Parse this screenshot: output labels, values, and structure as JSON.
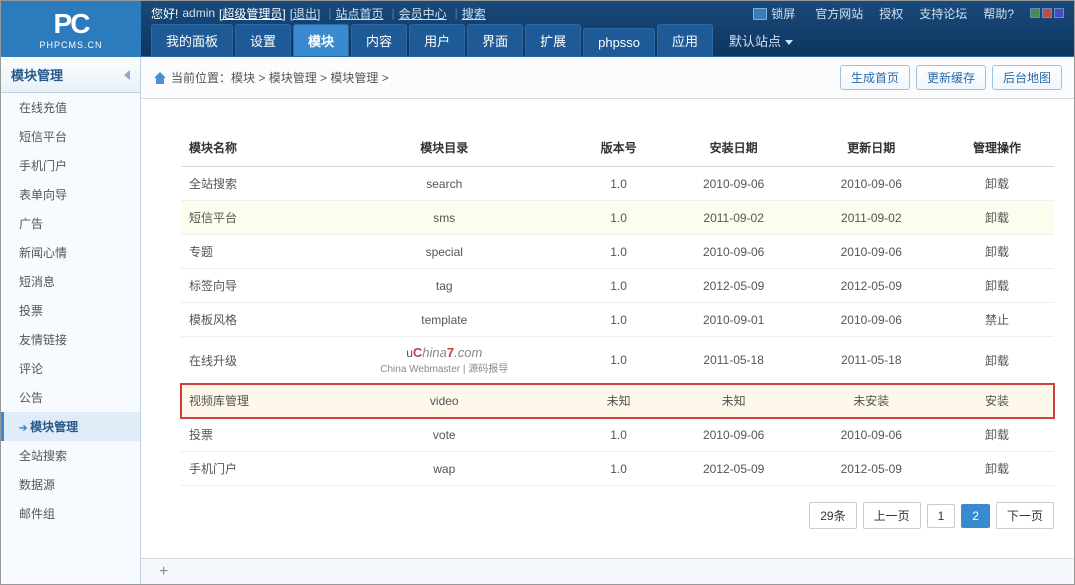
{
  "header": {
    "logo_main": "PC",
    "logo_sub": "PHPCMS.CN",
    "greeting": "您好!",
    "username": "admin",
    "role": "[超级管理员]",
    "logout": "[退出]",
    "links": [
      "站点首页",
      "会员中心",
      "搜索"
    ],
    "right_links": [
      "锁屏",
      "官方网站",
      "授权",
      "支持论坛",
      "帮助?"
    ]
  },
  "mainnav": {
    "tabs": [
      "我的面板",
      "设置",
      "模块",
      "内容",
      "用户",
      "界面",
      "扩展",
      "phpsso",
      "应用"
    ],
    "site_select": "默认站点"
  },
  "sidebar": {
    "title": "模块管理",
    "items": [
      "在线充值",
      "短信平台",
      "手机门户",
      "表单向导",
      "广告",
      "新闻心情",
      "短消息",
      "投票",
      "友情链接",
      "评论",
      "公告",
      "模块管理",
      "全站搜索",
      "数据源",
      "邮件组"
    ]
  },
  "breadcrumb": {
    "label": "当前位置：",
    "path": [
      "模块",
      "模块管理",
      "模块管理"
    ],
    "sep": " > ",
    "buttons": [
      "生成首页",
      "更新缓存",
      "后台地图"
    ]
  },
  "table": {
    "headers": [
      "模块名称",
      "模块目录",
      "版本号",
      "安装日期",
      "更新日期",
      "管理操作"
    ],
    "rows": [
      {
        "name": "全站搜索",
        "dir": "search",
        "ver": "1.0",
        "install": "2010-09-06",
        "update": "2010-09-06",
        "action": "卸载",
        "action_type": "uninstall"
      },
      {
        "name": "短信平台",
        "dir": "sms",
        "ver": "1.0",
        "install": "2011-09-02",
        "update": "2011-09-02",
        "action": "卸载",
        "action_type": "uninstall",
        "alt": true
      },
      {
        "name": "专题",
        "dir": "special",
        "ver": "1.0",
        "install": "2010-09-06",
        "update": "2010-09-06",
        "action": "卸载",
        "action_type": "uninstall"
      },
      {
        "name": "标签向导",
        "dir": "tag",
        "ver": "1.0",
        "install": "2012-05-09",
        "update": "2012-05-09",
        "action": "卸载",
        "action_type": "uninstall"
      },
      {
        "name": "模板风格",
        "dir": "template",
        "ver": "1.0",
        "install": "2010-09-01",
        "update": "2010-09-06",
        "action": "禁止",
        "action_type": "disabled"
      },
      {
        "name": "在线升级",
        "dir": "upgrade",
        "ver": "1.0",
        "install": "2011-05-18",
        "update": "2011-05-18",
        "action": "卸载",
        "action_type": "uninstall",
        "watermark": true
      },
      {
        "name": "视频库管理",
        "dir": "video",
        "ver": "未知",
        "install": "未知",
        "update": "未安装",
        "action": "安装",
        "action_type": "install",
        "highlight": true
      },
      {
        "name": "投票",
        "dir": "vote",
        "ver": "1.0",
        "install": "2010-09-06",
        "update": "2010-09-06",
        "action": "卸载",
        "action_type": "uninstall"
      },
      {
        "name": "手机门户",
        "dir": "wap",
        "ver": "1.0",
        "install": "2012-05-09",
        "update": "2012-05-09",
        "action": "卸载",
        "action_type": "uninstall"
      }
    ]
  },
  "watermark": {
    "line1": "China7.com",
    "line2": "China Webmaster | 源码报导"
  },
  "pagination": {
    "total": "29条",
    "prev": "上一页",
    "pages": [
      "1",
      "2"
    ],
    "next": "下一页",
    "active": 1
  },
  "footer": {
    "plus": "+"
  }
}
